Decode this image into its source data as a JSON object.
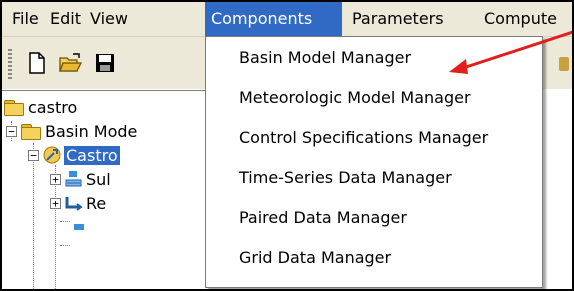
{
  "menubar": {
    "items": [
      "File",
      "Edit",
      "View",
      "Components",
      "Parameters",
      "Compute"
    ]
  },
  "tree": {
    "root": "castro",
    "basin_models": "Basin Mode",
    "castro_model": "Castro",
    "sub_label": "Sul",
    "reach_label": "Re"
  },
  "dropdown": {
    "items": [
      "Basin Model Manager",
      "Meteorologic Model Manager",
      "Control Specifications Manager",
      "Time-Series Data Manager",
      "Paired Data Manager",
      "Grid Data Manager"
    ]
  },
  "colors": {
    "menu_highlight": "#316ac5",
    "annotation_arrow": "#e0201c"
  }
}
